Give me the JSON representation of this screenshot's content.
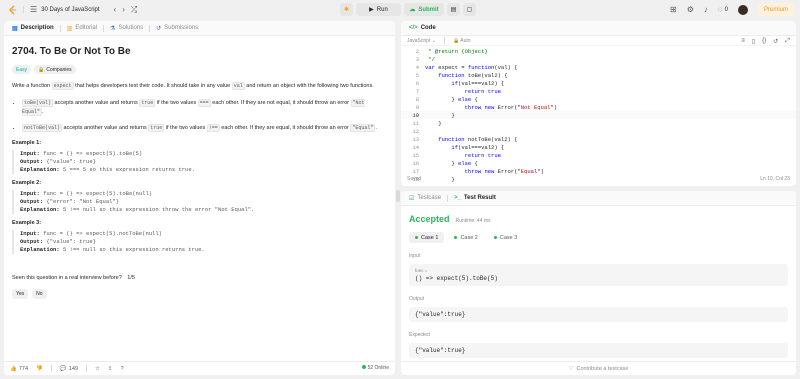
{
  "topbar": {
    "problem_list": "30 Days of JavaScript",
    "run_label": "Run",
    "submit_label": "Submit",
    "streak": "0",
    "premium_label": "Premium"
  },
  "left": {
    "tabs": [
      {
        "label": "Description"
      },
      {
        "label": "Editorial"
      },
      {
        "label": "Solutions"
      },
      {
        "label": "Submissions"
      }
    ],
    "title": "2704. To Be Or Not To Be",
    "difficulty": "Easy",
    "companies": "Companies",
    "intro_1": "Write a function ",
    "intro_code_1": "expect",
    "intro_2": " that helps developers test their code. It should take in any value ",
    "intro_code_2": "val",
    "intro_3": " and return an object with the following two functions.",
    "b1_code1": "toBe(val)",
    "b1_t1": " accepts another value and returns ",
    "b1_code2": "true",
    "b1_t2": " if the two values ",
    "b1_code3": "===",
    "b1_t3": " each other. If they are not equal, it should throw an error ",
    "b1_code4": "\"Not Equal\"",
    "b1_t4": ".",
    "b2_code1": "notToBe(val)",
    "b2_t1": " accepts another value and returns ",
    "b2_code2": "true",
    "b2_t2": " if the two values ",
    "b2_code3": "!==",
    "b2_t3": " each other. If they are equal, it should throw an error ",
    "b2_code4": "\"Equal\"",
    "b2_t4": ".",
    "examples": [
      {
        "label": "Example 1:",
        "input": "func = () => expect(5).toBe(5)",
        "output": "{\"value\": true}",
        "explanation": "5 === 5 so this expression returns true."
      },
      {
        "label": "Example 2:",
        "input": "func = () => expect(5).toBe(null)",
        "output": "{\"error\": \"Not Equal\"}",
        "explanation": "5 !== null so this expression throw the error \"Not Equal\"."
      },
      {
        "label": "Example 3:",
        "input": "func = () => expect(5).notToBe(null)",
        "output": "{\"value\": true}",
        "explanation": "5 !== null so this expression returns true."
      }
    ],
    "k_input": "Input:",
    "k_output": "Output:",
    "k_expl": "Explanation:",
    "interview_q": "Seen this question in a real interview before?",
    "interview_count": "1/5",
    "yes": "Yes",
    "no": "No",
    "likes": "774",
    "comments": "149",
    "online": "52 Online"
  },
  "code": {
    "tab_label": "Code",
    "language": "JavaScript",
    "auto": "Auto",
    "saved": "Saved",
    "position": "Ln 10, Col 23",
    "lines": [
      {
        "n": "2",
        "t": " * @return {Object}"
      },
      {
        "n": "3",
        "t": " */"
      },
      {
        "n": "4",
        "t": "var expect = function(val) {"
      },
      {
        "n": "5",
        "t": "    function toBe(val2) {"
      },
      {
        "n": "6",
        "t": "        if(val===val2) {"
      },
      {
        "n": "7",
        "t": "            return true"
      },
      {
        "n": "8",
        "t": "        } else {"
      },
      {
        "n": "9",
        "t": "            throw new Error(\"Not Equal\")"
      },
      {
        "n": "10",
        "t": "        }"
      },
      {
        "n": "11",
        "t": "    }"
      },
      {
        "n": "12",
        "t": ""
      },
      {
        "n": "13",
        "t": "    function notToBe(val2) {"
      },
      {
        "n": "14",
        "t": "        if(val===val2) {"
      },
      {
        "n": "15",
        "t": "            return true"
      },
      {
        "n": "16",
        "t": "        } else {"
      },
      {
        "n": "17",
        "t": "            throw new Error(\"Equal\")"
      },
      {
        "n": "18",
        "t": "        }"
      }
    ]
  },
  "result": {
    "tabs": [
      {
        "label": "Testcase"
      },
      {
        "label": "Test Result"
      }
    ],
    "status": "Accepted",
    "runtime": "Runtime: 44 ms",
    "cases": [
      "Case 1",
      "Case 2",
      "Case 3"
    ],
    "input_label": "Input",
    "input_sub": "func =",
    "input_value": "() => expect(5).toBe(5)",
    "output_label": "Output",
    "output_value": "{\"value\":true}",
    "expected_label": "Expected",
    "expected_value": "{\"value\":true}",
    "contribute": "Contribute a testcase"
  }
}
